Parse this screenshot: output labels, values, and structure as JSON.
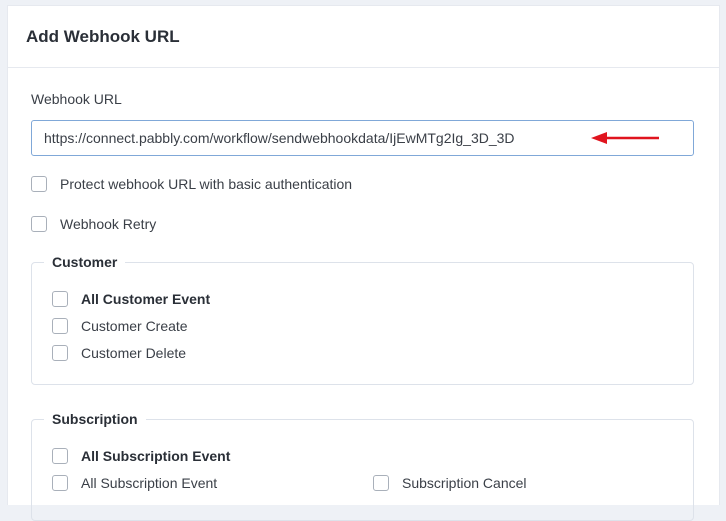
{
  "title": "Add Webhook URL",
  "webhook": {
    "label": "Webhook URL",
    "value": "https://connect.pabbly.com/workflow/sendwebhookdata/IjEwMTg2Ig_3D_3D"
  },
  "options": {
    "protect_label": "Protect webhook URL with basic authentication",
    "retry_label": "Webhook Retry"
  },
  "customer": {
    "legend": "Customer",
    "all": "All Customer Event",
    "create": "Customer Create",
    "delete": "Customer Delete"
  },
  "subscription": {
    "legend": "Subscription",
    "all": "All Subscription Event",
    "all_event": "All Subscription Event",
    "cancel": "Subscription Cancel"
  },
  "colors": {
    "arrow": "#e0141e",
    "input_border": "#80a8d8"
  }
}
